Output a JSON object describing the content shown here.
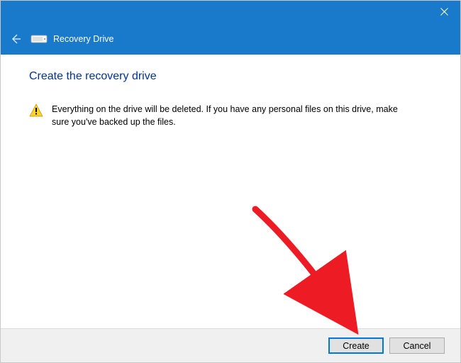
{
  "titlebar": {
    "close_label": "Close"
  },
  "header": {
    "back_label": "Back",
    "drive_icon_label": "drive-icon",
    "title": "Recovery Drive"
  },
  "content": {
    "heading": "Create the recovery drive",
    "warning_text": "Everything on the drive will be deleted. If you have any personal files on this drive, make sure you've backed up the files."
  },
  "footer": {
    "create_label": "Create",
    "cancel_label": "Cancel"
  },
  "colors": {
    "titlebar_bg": "#1979ca",
    "heading_color": "#003399",
    "primary_border": "#0078d7",
    "annotation_red": "#ed1c24"
  }
}
